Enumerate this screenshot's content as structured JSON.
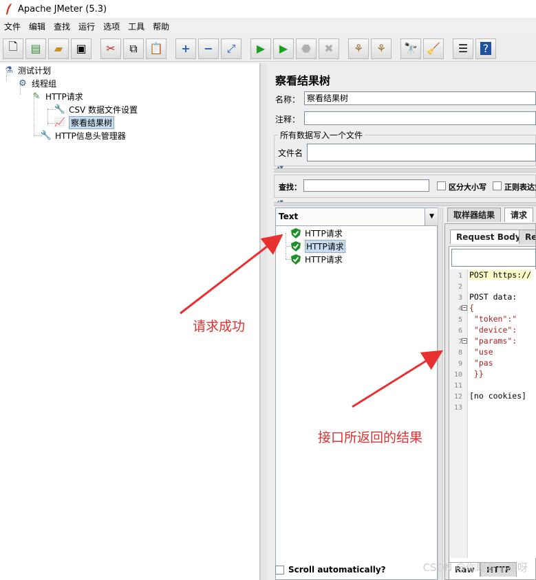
{
  "window": {
    "title": "Apache JMeter (5.3)",
    "icon": "feather-icon"
  },
  "menu": [
    "文件",
    "编辑",
    "查找",
    "运行",
    "选项",
    "工具",
    "帮助"
  ],
  "toolbar_icons": [
    "new-icon",
    "templates-icon",
    "open-icon",
    "save-icon",
    "cut-icon",
    "copy-icon",
    "paste-icon",
    "expand-icon",
    "collapse-icon",
    "toggle-icon",
    "start-icon",
    "start-no-timers-icon",
    "stop-icon",
    "shutdown-icon",
    "clear-icon",
    "clear-all-icon",
    "search-icon",
    "reset-search-icon",
    "function-helper-icon",
    "help-icon"
  ],
  "tree": {
    "nodes": [
      {
        "label": "测试计划",
        "icon": "flask-icon"
      },
      {
        "label": "线程组",
        "icon": "gear-icon"
      },
      {
        "label": "HTTP请求",
        "icon": "pipette-icon"
      },
      {
        "label": "CSV 数据文件设置",
        "icon": "wrench-icon"
      },
      {
        "label": "察看结果树",
        "icon": "chart-icon",
        "selected": true
      },
      {
        "label": "HTTP信息头管理器",
        "icon": "wrench-icon"
      }
    ]
  },
  "panel": {
    "title": "察看结果树",
    "name_label": "名称：",
    "name_value": "察看结果树",
    "comment_label": "注释：",
    "comment_value": "",
    "file_group_title": "所有数据写入一个文件",
    "file_label": "文件名",
    "file_value": "",
    "search_label": "查找：",
    "search_value": "",
    "case_label": "区分大小写",
    "regex_label": "正则表达式"
  },
  "results": {
    "renderer": "Text",
    "items": [
      {
        "label": "HTTP请求",
        "status": "success"
      },
      {
        "label": "HTTP请求",
        "status": "success",
        "selected": true
      },
      {
        "label": "HTTP请求",
        "status": "success"
      }
    ],
    "scroll_label": "Scroll automatically?"
  },
  "tabs": {
    "sampler": "取样器结果",
    "request": "请求"
  },
  "subtabs": {
    "body": "Request Body",
    "headers": "Rec"
  },
  "bottom_tabs": {
    "raw": "Raw",
    "http": "HTTP"
  },
  "code_lines": [
    {
      "n": "1",
      "text": "POST https://",
      "hl": true
    },
    {
      "n": "2",
      "text": ""
    },
    {
      "n": "3",
      "text": "POST data:"
    },
    {
      "n": "4",
      "text": "{"
    },
    {
      "n": "5",
      "text": "    \"token\":\""
    },
    {
      "n": "6",
      "text": "    \"device\":"
    },
    {
      "n": "7",
      "text": "    \"params\":"
    },
    {
      "n": "8",
      "text": "        \"use"
    },
    {
      "n": "9",
      "text": "        \"pas"
    },
    {
      "n": "10",
      "text": "        }}"
    },
    {
      "n": "11",
      "text": ""
    },
    {
      "n": "12",
      "text": "[no cookies]"
    },
    {
      "n": "13",
      "text": ""
    }
  ],
  "annotations": {
    "success": "请求成功",
    "result": "接口所返回的结果"
  },
  "watermark": "CSDN @你瞪着小甜呀",
  "colors": {
    "annotation": "#e03030",
    "selection": "#c8dcf0"
  }
}
